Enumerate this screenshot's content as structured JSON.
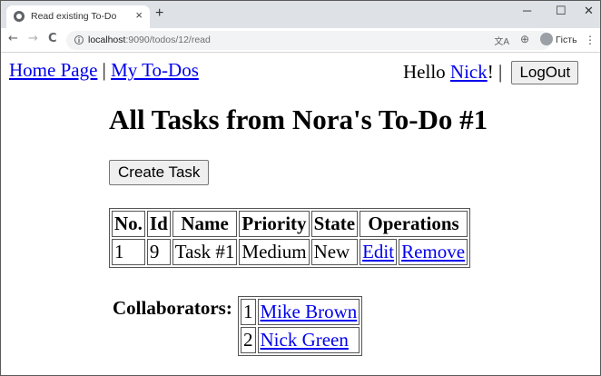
{
  "browser": {
    "tab_title": "Read existing To-Do",
    "tab_close": "×",
    "new_tab": "+",
    "win_minimize": "─",
    "win_maximize": "☐",
    "win_close": "✕",
    "nav_back": "←",
    "nav_forward": "→",
    "nav_reload": "C",
    "url_host": "localhost",
    "url_path": ":9090/todos/12/read",
    "translate_icon": "文A",
    "zoom_icon": "⊕",
    "profile_label": "Гість",
    "menu": "⋮"
  },
  "nav": {
    "home": "Home Page",
    "separator": "|",
    "my_todos": "My To-Dos"
  },
  "user": {
    "greeting": "Hello",
    "name": "Nick",
    "suffix": "! |",
    "logout": "LogOut"
  },
  "heading": "All Tasks from Nora's To-Do #1",
  "create_button": "Create Task",
  "tasks": {
    "headers": [
      "No.",
      "Id",
      "Name",
      "Priority",
      "State",
      "Operations"
    ],
    "rows": [
      {
        "no": "1",
        "id": "9",
        "name": "Task #1",
        "priority": "Medium",
        "state": "New",
        "edit": "Edit",
        "remove": "Remove"
      }
    ]
  },
  "collaborators": {
    "label": "Collaborators:",
    "items": [
      {
        "no": "1",
        "name": "Mike Brown"
      },
      {
        "no": "2",
        "name": "Nick Green"
      }
    ]
  }
}
